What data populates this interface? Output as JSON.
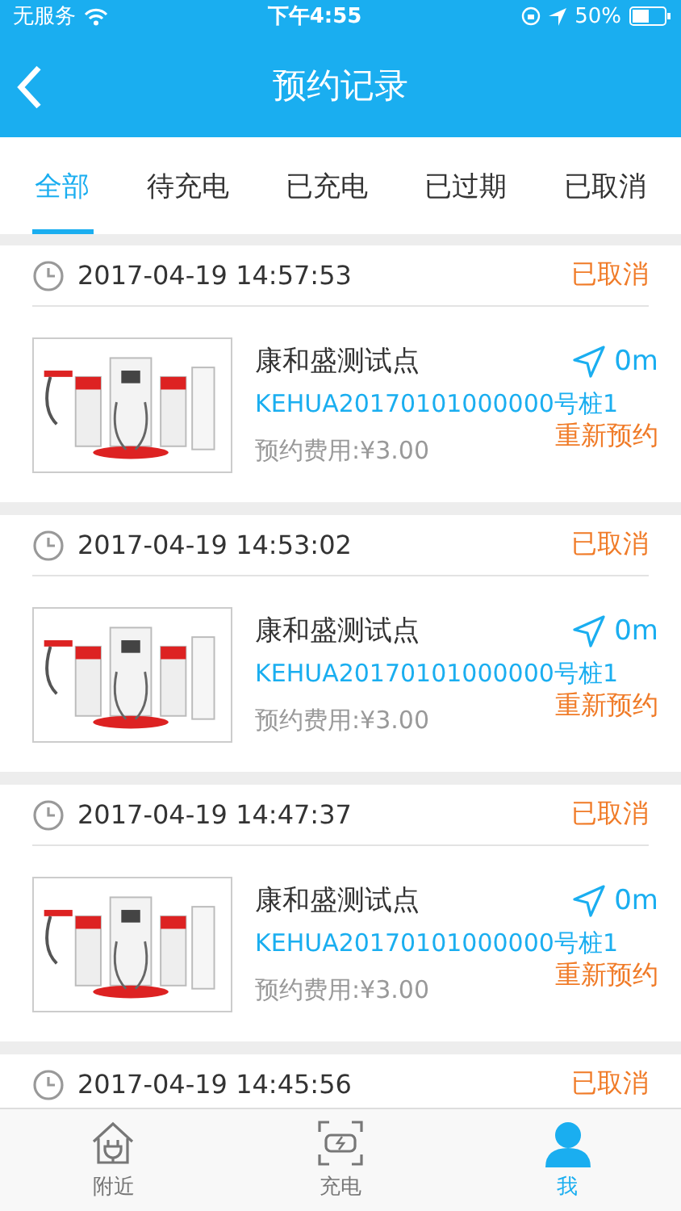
{
  "status_bar": {
    "carrier": "无服务",
    "time": "下午4:55",
    "battery": "50%"
  },
  "nav": {
    "title": "预约记录"
  },
  "tabs": [
    {
      "label": "全部",
      "selected": true
    },
    {
      "label": "待充电",
      "selected": false
    },
    {
      "label": "已充电",
      "selected": false
    },
    {
      "label": "已过期",
      "selected": false
    },
    {
      "label": "已取消",
      "selected": false
    }
  ],
  "records": [
    {
      "time": "2017-04-19 14:57:53",
      "status": "已取消",
      "station": "康和盛测试点",
      "code": "KEHUA20170101000000号桩1",
      "fee": "预约费用:¥3.00",
      "distance": "0m",
      "action": "重新预约"
    },
    {
      "time": "2017-04-19 14:53:02",
      "status": "已取消",
      "station": "康和盛测试点",
      "code": "KEHUA20170101000000号桩1",
      "fee": "预约费用:¥3.00",
      "distance": "0m",
      "action": "重新预约"
    },
    {
      "time": "2017-04-19 14:47:37",
      "status": "已取消",
      "station": "康和盛测试点",
      "code": "KEHUA20170101000000号桩1",
      "fee": "预约费用:¥3.00",
      "distance": "0m",
      "action": "重新预约"
    },
    {
      "time": "2017-04-19 14:45:56",
      "status": "已取消"
    }
  ],
  "tab_bar": [
    {
      "label": "附近",
      "kind": "nearby",
      "selected": false
    },
    {
      "label": "充电",
      "kind": "charge",
      "selected": false
    },
    {
      "label": "我",
      "kind": "me",
      "selected": true
    }
  ]
}
